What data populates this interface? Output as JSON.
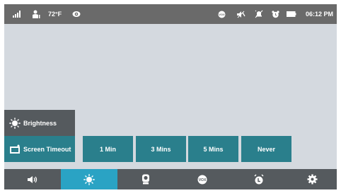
{
  "status_bar": {
    "signal_icon": "signal-bars-icon",
    "baby_icon": "baby-temperature-icon",
    "temperature": "72°F",
    "eye_icon": "eye-icon",
    "vox_icon": "vox-icon",
    "speaker_off_icon": "speaker-muted-icon",
    "alert_off_icon": "alert-off-icon",
    "alarm_icon": "alarm-clock-icon",
    "battery_icon": "battery-icon",
    "time": "06:12 PM"
  },
  "settings": {
    "tabs": [
      {
        "label": "Brightness",
        "icon": "sun-icon"
      },
      {
        "label": "Screen Timeout",
        "icon": "screen-icon"
      }
    ],
    "timeout_options": [
      "1 Min",
      "3 Mins",
      "5 Mins",
      "Never"
    ]
  },
  "bottom_nav": {
    "items": [
      {
        "icon": "volume-icon",
        "active": false
      },
      {
        "icon": "brightness-icon",
        "active": true
      },
      {
        "icon": "camera-icon",
        "active": false
      },
      {
        "icon": "vox-icon",
        "active": false
      },
      {
        "icon": "alarm-icon",
        "active": false
      },
      {
        "icon": "settings-gear-icon",
        "active": false
      }
    ]
  },
  "colors": {
    "status_bar_bg": "#6a6a6a",
    "screen_bg": "#d4d9df",
    "teal": "#2a7f8c",
    "dark_gray": "#555a5e",
    "active_nav": "#2aa3c4"
  }
}
